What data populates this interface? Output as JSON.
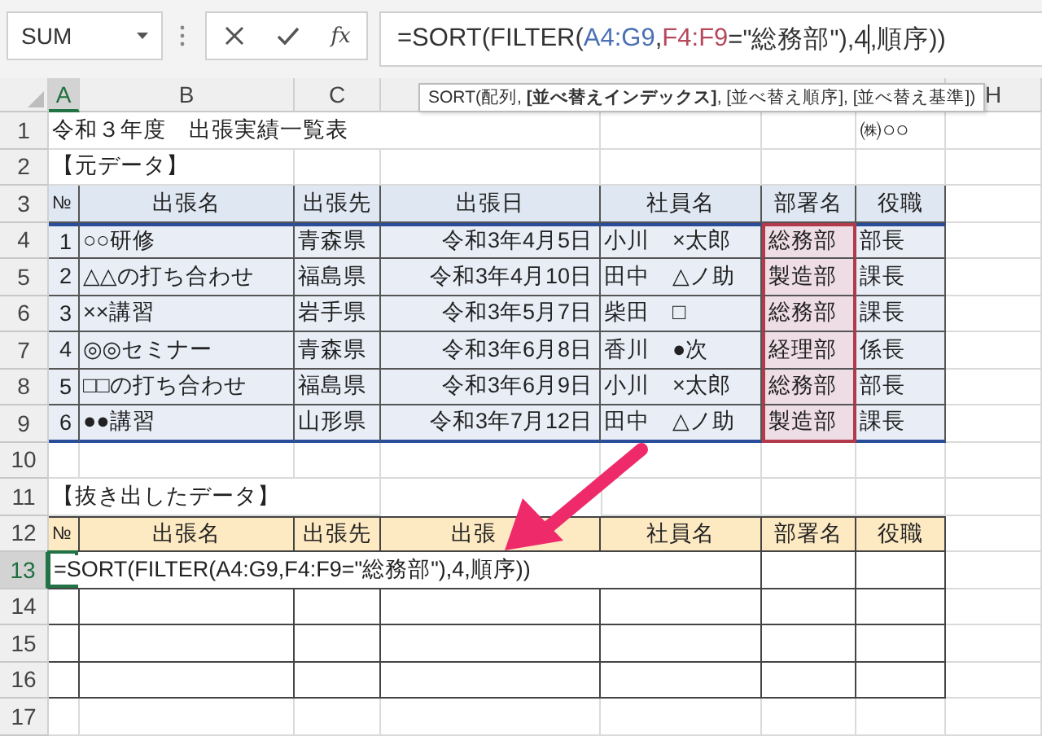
{
  "name_box": {
    "value": "SUM"
  },
  "formula_bar": {
    "function_button": "fx",
    "segments": [
      {
        "text": "=SORT(FILTER("
      },
      {
        "text": "A4:G9",
        "color": "#4a6fb5"
      },
      {
        "text": ","
      },
      {
        "text": "F4:F9",
        "color": "#b5485a"
      },
      {
        "text": "=\"総務部\"),4"
      },
      {
        "text": ",順序))"
      }
    ]
  },
  "tooltip": "SORT(配列, **[並べ替えインデックス]**, [並べ替え順序], [並べ替え基準])",
  "columns": [
    {
      "label": "A",
      "selected": true
    },
    {
      "label": "B",
      "selected": false
    },
    {
      "label": "C",
      "selected": false
    },
    {
      "label": "H",
      "selected": false
    }
  ],
  "row_numbers": [
    {
      "label": "1",
      "selected": false
    },
    {
      "label": "2",
      "selected": false
    },
    {
      "label": "3",
      "selected": false
    },
    {
      "label": "4",
      "selected": false
    },
    {
      "label": "5",
      "selected": false
    },
    {
      "label": "6",
      "selected": false
    },
    {
      "label": "7",
      "selected": false
    },
    {
      "label": "8",
      "selected": false
    },
    {
      "label": "9",
      "selected": false
    },
    {
      "label": "10",
      "selected": false
    },
    {
      "label": "11",
      "selected": false
    },
    {
      "label": "12",
      "selected": false
    },
    {
      "label": "13",
      "selected": true
    },
    {
      "label": "14",
      "selected": false
    },
    {
      "label": "15",
      "selected": false
    },
    {
      "label": "16",
      "selected": false
    },
    {
      "label": "17",
      "selected": false
    }
  ],
  "title": "令和３年度　出張実績一覧表",
  "company": "㈱○○",
  "source_label": "【元データ】",
  "source_table": {
    "columns": [
      "№",
      "出張名",
      "出張先",
      "出張日",
      "社員名",
      "部署名",
      "役職"
    ],
    "rows": [
      [
        "1",
        "○○研修",
        "青森県",
        "令和3年4月5日",
        "小川　×太郎",
        "総務部",
        "部長"
      ],
      [
        "2",
        "△△の打ち合わせ",
        "福島県",
        "令和3年4月10日",
        "田中　△ノ助",
        "製造部",
        "課長"
      ],
      [
        "3",
        "××講習",
        "岩手県",
        "令和3年5月7日",
        "柴田　□",
        "総務部",
        "課長"
      ],
      [
        "4",
        "◎◎セミナー",
        "青森県",
        "令和3年6月8日",
        "香川　●次",
        "経理部",
        "係長"
      ],
      [
        "5",
        "□□の打ち合わせ",
        "福島県",
        "令和3年6月9日",
        "小川　×太郎",
        "総務部",
        "部長"
      ],
      [
        "6",
        "●●講習",
        "山形県",
        "令和3年7月12日",
        "田中　△ノ助",
        "製造部",
        "課長"
      ]
    ]
  },
  "result_label": "【抜き出したデータ】",
  "result_table": {
    "columns": [
      "№",
      "出張名",
      "出張先",
      "出張",
      "社員名",
      "部署名",
      "役職"
    ],
    "formula": "=SORT(FILTER(A4:G9,F4:F9=\"総務部\"),4,順序))"
  }
}
